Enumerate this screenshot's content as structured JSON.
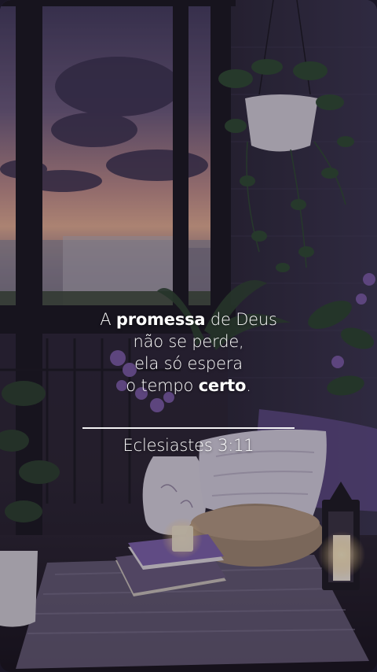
{
  "quote": {
    "line1": {
      "pre": "A ",
      "bold": "promessa",
      "post": " de Deus"
    },
    "line2": "não se perde,",
    "line3": "ela só espera",
    "line4": {
      "pre": "o tempo ",
      "bold": "certo",
      "post": "."
    }
  },
  "reference": "Eclesiastes 3:11",
  "colors": {
    "text": "#ffffff",
    "sky_top": "#4a4266",
    "sky_glow": "#e9a98c",
    "accent_purple": "#7b5aa6"
  }
}
